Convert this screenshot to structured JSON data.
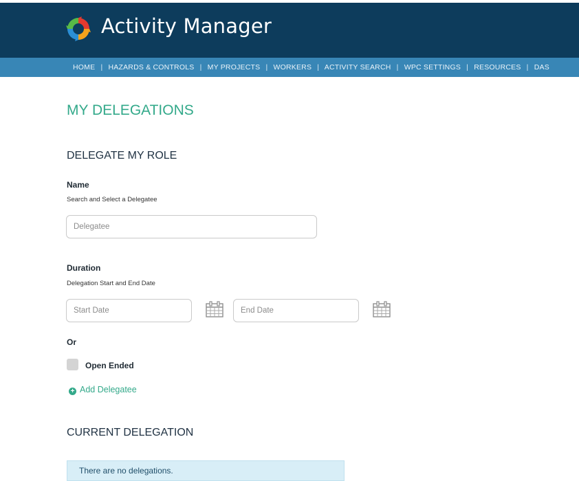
{
  "app": {
    "title": "Activity Manager"
  },
  "nav": {
    "items": [
      "HOME",
      "HAZARDS & CONTROLS",
      "MY PROJECTS",
      "WORKERS",
      "ACTIVITY SEARCH",
      "WPC SETTINGS",
      "RESOURCES",
      "DAS"
    ],
    "separator": "|"
  },
  "page": {
    "title": "MY DELEGATIONS"
  },
  "delegate": {
    "section_title": "DELEGATE MY ROLE",
    "name_label": "Name",
    "name_help": "Search and Select a Delegatee",
    "delegatee_placeholder": "Delegatee",
    "duration_label": "Duration",
    "duration_help": "Delegation Start and End Date",
    "start_placeholder": "Start Date",
    "end_placeholder": "End Date",
    "or_label": "Or",
    "open_ended_label": "Open Ended",
    "add_link": "Add Delegatee"
  },
  "current": {
    "section_title": "CURRENT DELEGATION",
    "empty_message": "There are no delegations."
  },
  "colors": {
    "header": "#0d3c5c",
    "navbar": "#3886b6",
    "accent": "#33a98a"
  },
  "icons": {
    "logo": "ring-logo-icon",
    "calendar": "calendar-icon",
    "add": "plus-circle-icon"
  }
}
